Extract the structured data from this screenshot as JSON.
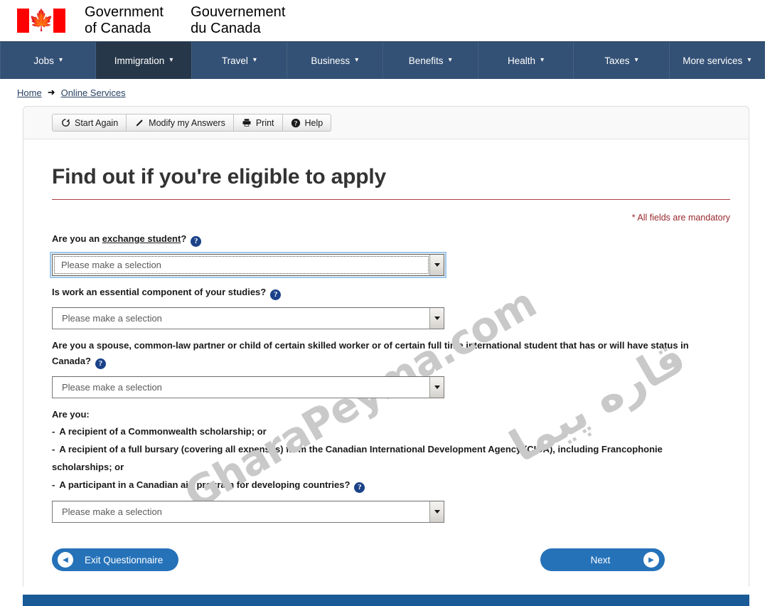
{
  "brand": {
    "flag_icon": "canada-flag-icon",
    "leaf_glyph": "🍁",
    "wordmark_en": "Government\nof Canada",
    "wordmark_fr": "Gouvernement\ndu Canada"
  },
  "mainnav": {
    "items": [
      {
        "label": "Jobs",
        "active": false
      },
      {
        "label": "Immigration",
        "active": true
      },
      {
        "label": "Travel",
        "active": false
      },
      {
        "label": "Business",
        "active": false
      },
      {
        "label": "Benefits",
        "active": false
      },
      {
        "label": "Health",
        "active": false
      },
      {
        "label": "Taxes",
        "active": false
      },
      {
        "label": "More services",
        "active": false
      }
    ],
    "caret_glyph": "▾",
    "bg_color": "#335075",
    "active_bg_color": "#26374a"
  },
  "breadcrumb": {
    "home": "Home",
    "separator": "➜",
    "current": "Online Services"
  },
  "toolbar": {
    "buttons": [
      {
        "label": "Start Again",
        "icon": "refresh-icon",
        "glyph": "↺"
      },
      {
        "label": "Modify my Answers",
        "icon": "pencil-icon",
        "glyph": "✎"
      },
      {
        "label": "Print",
        "icon": "printer-icon",
        "glyph": "⎙"
      },
      {
        "label": "Help",
        "icon": "question-mark-icon",
        "glyph": "?"
      }
    ]
  },
  "main": {
    "title": "Find out if you're eligible to apply",
    "title_rule_color": "#af3c43",
    "mandatory_note": "* All fields are mandatory",
    "mandatory_color": "#98282d",
    "help_glyph": "?",
    "questions": [
      {
        "id": "exchange-student",
        "text_before": "Are you an ",
        "link_text": "exchange student",
        "text_after": "?",
        "select_value": "Please make a selection",
        "focused": true
      },
      {
        "id": "work-essential",
        "text_before": "Is work an essential component of your studies?",
        "link_text": "",
        "text_after": "",
        "select_value": "Please make a selection",
        "focused": false
      },
      {
        "id": "spouse-partner-child",
        "text_before": "Are you a spouse, common-law partner or child of certain skilled worker or of certain full time international student that has or will have status in Canada?",
        "link_text": "",
        "text_after": "",
        "select_value": "Please make a selection",
        "focused": false
      }
    ],
    "list_question": {
      "id": "scholarship-recipient",
      "lead": "Are you:",
      "items": [
        "A recipient of a Commonwealth scholarship; or",
        "A recipient of a full bursary (covering all expenses) from the Canadian International Development Agency (CIDA), including Francophonie scholarships; or",
        "A participant in a Canadian aid program for developing countries?"
      ],
      "dash": "-",
      "select_value": "Please make a selection"
    },
    "actions": {
      "exit_label": "Exit Questionnaire",
      "exit_icon": "arrow-left-icon",
      "exit_glyph": "◀",
      "next_label": "Next",
      "next_icon": "arrow-right-icon",
      "next_glyph": "▶",
      "button_color": "#2572b9"
    }
  },
  "watermark": {
    "latin": "GharaPeyma.com",
    "persian": "قاره پیما",
    "color": "#c9c9c9"
  },
  "footer": {
    "bar_color": "#1a5a96"
  }
}
